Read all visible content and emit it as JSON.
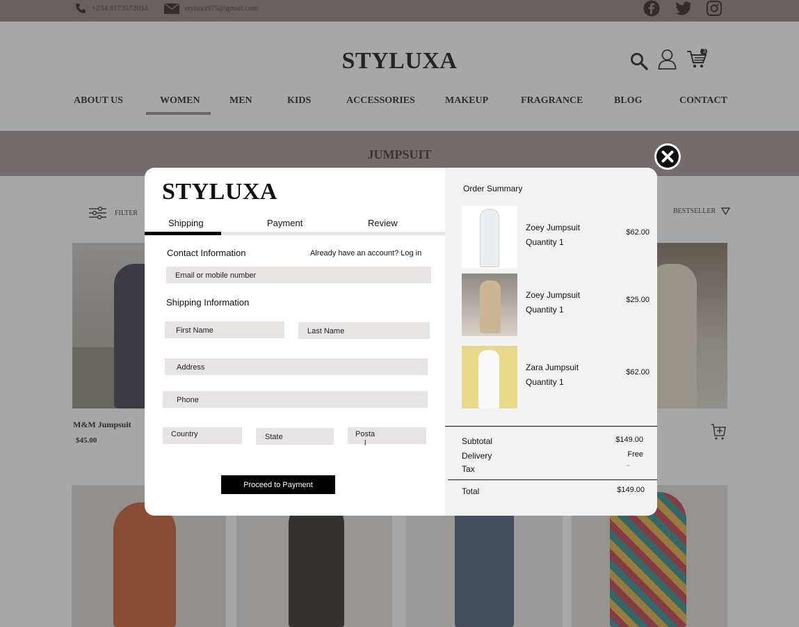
{
  "topbar": {
    "phone": "+234 8173572034",
    "email": "styluxa975@gmail.com"
  },
  "header": {
    "logo": "STYLUXA",
    "cart_count": "3"
  },
  "nav": {
    "items": [
      "ABOUT US",
      "WOMEN",
      "MEN",
      "KIDS",
      "ACCESSORIES",
      "MAKEUP",
      "FRAGRANCE",
      "BLOG",
      "CONTACT"
    ]
  },
  "banner": {
    "title": "JUMPSUIT"
  },
  "toolbar": {
    "filter_label": "FILTER",
    "sort_label": "BESTSELLER"
  },
  "products": [
    {
      "title": "M&M Jumpsuit",
      "price": "$45.00"
    }
  ],
  "checkout": {
    "logo": "STYLUXA",
    "tabs": [
      "Shipping",
      "Payment",
      "Review"
    ],
    "contact_heading": "Contact Information",
    "login_prompt": "Already have an account? Log in",
    "email_placeholder": "Email or mobile number",
    "shipping_heading": "Shipping Information",
    "first_name": "First Name",
    "last_name": "Last Name",
    "address": "Address",
    "phone": "Phone",
    "country": "Country",
    "state": "State",
    "postal_line1": "Posta",
    "postal_line2": "l",
    "proceed_label": "Proceed to Payment"
  },
  "order_summary": {
    "title": "Order Summary",
    "items": [
      {
        "name": "Zoey Jumpsuit",
        "quantity": "Quantity   1",
        "price": "$62.00"
      },
      {
        "name": "Zoey Jumpsuit",
        "quantity": "Quantity   1",
        "price": "$25.00"
      },
      {
        "name": "Zara Jumpsuit",
        "quantity": "Quantity   1",
        "price": "$62.00"
      }
    ],
    "subtotal_label": "Subtotal",
    "subtotal_value": "$149.00",
    "delivery_label": "Delivery",
    "delivery_value": "Free",
    "tax_label": "Tax",
    "tax_value": "-",
    "total_label": "Total",
    "total_value": "$149.00"
  },
  "colors": {
    "topbar": "#8e7f7f",
    "banner": "#a39494",
    "field_bg": "#e9e4e4",
    "button": "#000000"
  }
}
